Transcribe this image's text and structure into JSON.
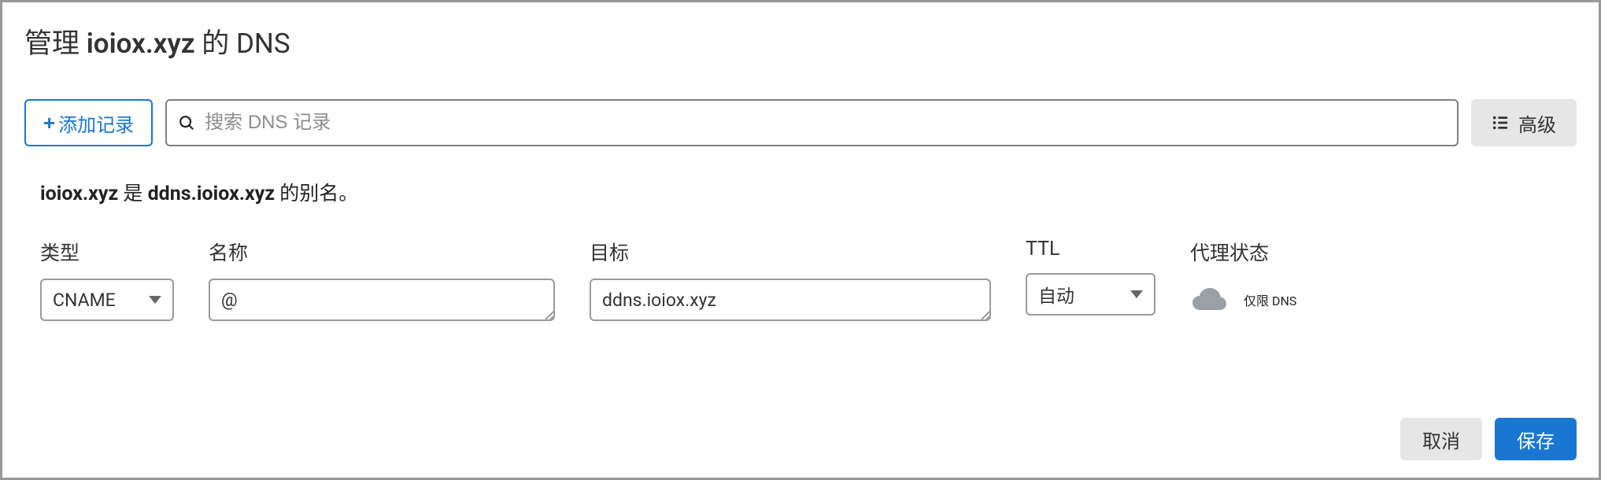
{
  "title": {
    "prefix": "管理 ",
    "domain": "ioiox.xyz",
    "suffix": " 的 DNS"
  },
  "toolbar": {
    "add_label": "添加记录",
    "search_placeholder": "搜索 DNS 记录",
    "advanced_label": "高级"
  },
  "alias": {
    "domain": "ioiox.xyz",
    "mid": " 是 ",
    "target": "ddns.ioiox.xyz",
    "suffix": " 的别名。"
  },
  "fields": {
    "type": {
      "label": "类型",
      "value": "CNAME"
    },
    "name": {
      "label": "名称",
      "value": "@"
    },
    "target": {
      "label": "目标",
      "value": "ddns.ioiox.xyz"
    },
    "ttl": {
      "label": "TTL",
      "value": "自动"
    },
    "proxy": {
      "label": "代理状态",
      "value": "仅限 DNS"
    }
  },
  "footer": {
    "cancel_label": "取消",
    "save_label": "保存"
  }
}
